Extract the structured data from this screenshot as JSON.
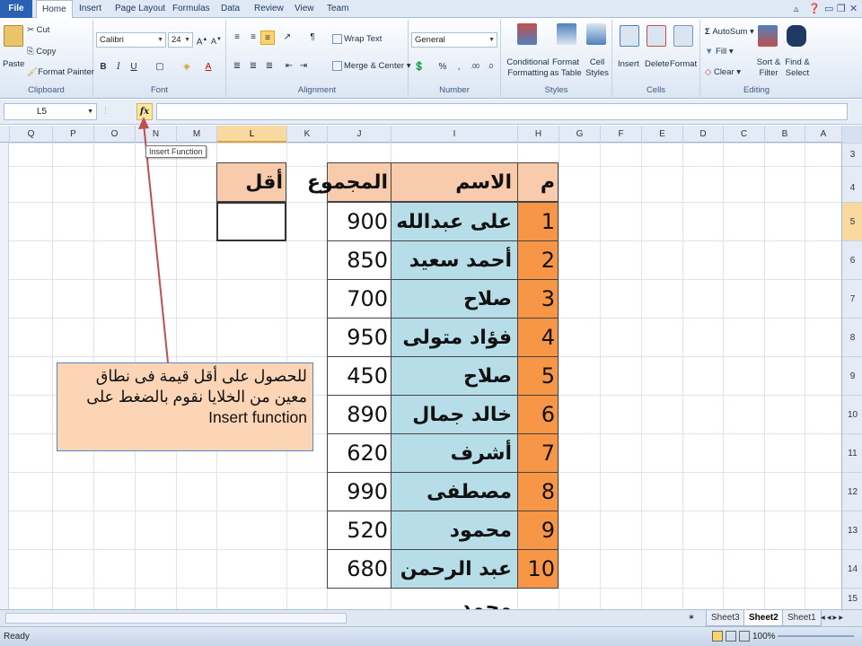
{
  "ribbon_tabs": [
    "File",
    "Home",
    "Insert",
    "Page Layout",
    "Formulas",
    "Data",
    "Review",
    "View",
    "Team"
  ],
  "clipboard": {
    "paste": "Paste",
    "cut": "Cut",
    "copy": "Copy",
    "format_painter": "Format Painter",
    "label": "Clipboard"
  },
  "font": {
    "family": "Calibri",
    "size": "24",
    "label": "Font"
  },
  "alignment": {
    "wrap_text": "Wrap Text",
    "merge_center": "Merge & Center",
    "label": "Alignment"
  },
  "number": {
    "format": "General",
    "percent": "%",
    "comma": ",",
    "label": "Number"
  },
  "styles": {
    "conditional": "Conditional Formatting",
    "as_table": "Format as Table",
    "cell_styles": "Cell Styles",
    "label": "Styles"
  },
  "cells_group": {
    "insert": "Insert",
    "delete": "Delete",
    "format": "Format",
    "label": "Cells"
  },
  "editing": {
    "autosum": "AutoSum",
    "fill": "Fill",
    "clear": "Clear",
    "sort_filter": "Sort & Filter",
    "find_select": "Find & Select",
    "label": "Editing"
  },
  "formula_bar": {
    "name_box": "L5",
    "fx": "fx",
    "tooltip": "Insert Function"
  },
  "columns": [
    "Q",
    "P",
    "O",
    "N",
    "M",
    "L",
    "K",
    "J",
    "I",
    "H",
    "G",
    "F",
    "E",
    "D",
    "C",
    "B",
    "A"
  ],
  "rows": [
    "3",
    "4",
    "5",
    "6",
    "7",
    "8",
    "9",
    "10",
    "11",
    "12",
    "13",
    "14",
    "15"
  ],
  "table": {
    "headers": {
      "index": "م",
      "name": "الاسم",
      "total": "المجموع",
      "min": "أقل قيمة"
    },
    "records": [
      {
        "index": "1",
        "name": "على عبدالله",
        "total": "900"
      },
      {
        "index": "2",
        "name": "أحمد سعيد",
        "total": "850"
      },
      {
        "index": "3",
        "name": "صلاح إبراهيم",
        "total": "700"
      },
      {
        "index": "4",
        "name": "فؤاد متولى",
        "total": "950"
      },
      {
        "index": "5",
        "name": "صلاح عبدالله",
        "total": "450"
      },
      {
        "index": "6",
        "name": "خالد جمال",
        "total": "890"
      },
      {
        "index": "7",
        "name": "أشرف شوقي",
        "total": "620"
      },
      {
        "index": "8",
        "name": "مصطفى محمد",
        "total": "990"
      },
      {
        "index": "9",
        "name": "محمود فوزي",
        "total": "520"
      },
      {
        "index": "10",
        "name": "عبد الرحمن محمد",
        "total": "680"
      }
    ]
  },
  "callout": {
    "line1": "للحصول على أقل قيمة فى نطاق",
    "line2": "معين من الخلايا نقوم بالضغط على",
    "line3": "Insert function"
  },
  "sheets": [
    "Sheet3",
    "Sheet2",
    "Sheet1"
  ],
  "active_sheet": "Sheet2",
  "status": {
    "ready": "Ready",
    "zoom": "100%"
  },
  "colors": {
    "header_fill": "#f8cbad",
    "name_fill": "#b7dee8",
    "index_fill": "#f79646",
    "callout_fill": "#fbd5b5",
    "arrow": "#c0504d"
  }
}
